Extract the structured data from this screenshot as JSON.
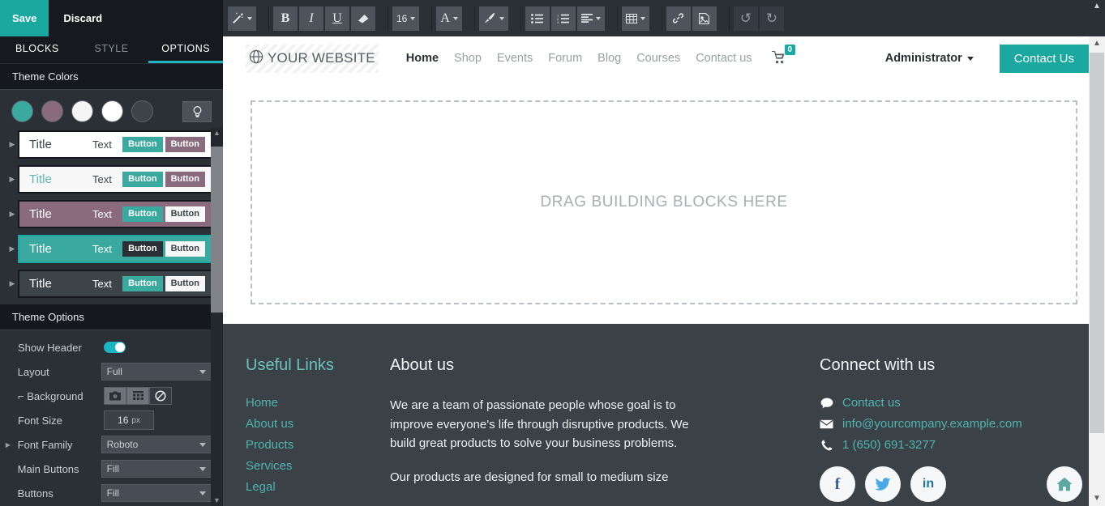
{
  "editor": {
    "save_label": "Save",
    "discard_label": "Discard",
    "tabs": [
      {
        "label": "BLOCKS",
        "active": false
      },
      {
        "label": "STYLE",
        "active": false
      },
      {
        "label": "OPTIONS",
        "active": true
      }
    ],
    "theme_colors": {
      "section_title": "Theme Colors",
      "swatches": [
        "#3aa9a0",
        "#8a6b7d",
        "#f5f5f5",
        "#ffffff",
        "#3c4449"
      ],
      "bulb_icon": "lightbulb-icon",
      "previews": [
        {
          "title": "Title",
          "text": "Text",
          "button1": "Button",
          "button2": "Button",
          "bg": "#ffffff",
          "title_color": "#3c4449",
          "text_color": "#3c4449",
          "b1_bg": "#3aa9a0",
          "b1_fg": "#ffffff",
          "b2_bg": "#8a6b7d",
          "b2_fg": "#ffffff",
          "selected": false
        },
        {
          "title": "Title",
          "text": "Text",
          "button1": "Button",
          "button2": "Button",
          "bg": "#f7f7f7",
          "title_color": "#5fb6b0",
          "text_color": "#3c4449",
          "b1_bg": "#3aa9a0",
          "b1_fg": "#ffffff",
          "b2_bg": "#8a6b7d",
          "b2_fg": "#ffffff",
          "selected": false
        },
        {
          "title": "Title",
          "text": "Text",
          "button1": "Button",
          "button2": "Button",
          "bg": "#8a6b7d",
          "title_color": "#ffffff",
          "text_color": "#ffffff",
          "b1_bg": "#3aa9a0",
          "b1_fg": "#ffffff",
          "b2_bg": "#f7f7f7",
          "b2_fg": "#3c4449",
          "selected": false
        },
        {
          "title": "Title",
          "text": "Text",
          "button1": "Button",
          "button2": "Button",
          "bg": "#3aa9a0",
          "title_color": "#ffffff",
          "text_color": "#ffffff",
          "b1_bg": "#2b3036",
          "b1_fg": "#ffffff",
          "b2_bg": "#f7f7f7",
          "b2_fg": "#3c4449",
          "selected": true
        },
        {
          "title": "Title",
          "text": "Text",
          "button1": "Button",
          "button2": "Button",
          "bg": "#3c4449",
          "title_color": "#ffffff",
          "text_color": "#ffffff",
          "b1_bg": "#3aa9a0",
          "b1_fg": "#ffffff",
          "b2_bg": "#f7f7f7",
          "b2_fg": "#3c4449",
          "selected": false
        }
      ]
    },
    "theme_options": {
      "section_title": "Theme Options",
      "show_header": {
        "label": "Show Header",
        "value": "on"
      },
      "layout": {
        "label": "Layout",
        "value": "Full"
      },
      "background": {
        "label": "⌐ Background",
        "buttons": [
          "camera-icon",
          "grid-icon",
          "no-background-icon"
        ],
        "active": "no-background-icon"
      },
      "font_size": {
        "label": "Font Size",
        "value": "16",
        "unit": "px"
      },
      "font_family": {
        "label": "Font Family",
        "value": "Roboto"
      },
      "main_buttons": {
        "label": "Main Buttons",
        "value": "Fill"
      },
      "buttons": {
        "label": "Buttons",
        "value": "Fill"
      }
    }
  },
  "toolbar": {
    "groups": [
      {
        "buttons": [
          {
            "icon": "magic-wand-icon",
            "glyph": "✨",
            "dropdown": true,
            "flat": false
          }
        ]
      },
      {
        "buttons": [
          {
            "icon": "bold-icon",
            "glyph": "B",
            "dropdown": false,
            "flat": false
          },
          {
            "icon": "italic-icon",
            "glyph": "I",
            "dropdown": false,
            "flat": false
          },
          {
            "icon": "underline-icon",
            "glyph": "U",
            "dropdown": false,
            "flat": false
          },
          {
            "icon": "clear-format-icon",
            "glyph": "◣",
            "dropdown": false,
            "flat": false
          }
        ]
      },
      {
        "buttons": [
          {
            "icon": "font-size-icon",
            "glyph": "16",
            "dropdown": true,
            "flat": false
          }
        ]
      },
      {
        "buttons": [
          {
            "icon": "text-color-icon",
            "glyph": "A",
            "dropdown": true,
            "flat": false
          }
        ]
      },
      {
        "buttons": [
          {
            "icon": "brush-icon",
            "glyph": "🖌",
            "dropdown": true,
            "flat": false
          }
        ]
      },
      {
        "buttons": [
          {
            "icon": "bullet-list-icon",
            "glyph": "☰",
            "dropdown": false,
            "flat": false
          },
          {
            "icon": "numbered-list-icon",
            "glyph": "≡",
            "dropdown": false,
            "flat": false
          },
          {
            "icon": "align-icon",
            "glyph": "≣",
            "dropdown": true,
            "flat": false
          }
        ]
      },
      {
        "buttons": [
          {
            "icon": "table-icon",
            "glyph": "⊞",
            "dropdown": true,
            "flat": false
          }
        ]
      },
      {
        "buttons": [
          {
            "icon": "link-icon",
            "glyph": "🔗",
            "dropdown": false,
            "flat": false
          },
          {
            "icon": "image-icon",
            "glyph": "🖼",
            "dropdown": false,
            "flat": false
          }
        ]
      },
      {
        "buttons": [
          {
            "icon": "undo-icon",
            "glyph": "↺",
            "dropdown": false,
            "flat": true
          },
          {
            "icon": "redo-icon",
            "glyph": "↻",
            "dropdown": false,
            "flat": true
          }
        ]
      }
    ]
  },
  "site": {
    "header": {
      "logo_icon": "globe-icon",
      "logo_text": "YOUR WEBSITE",
      "nav": [
        {
          "label": "Home",
          "active": true
        },
        {
          "label": "Shop",
          "active": false
        },
        {
          "label": "Events",
          "active": false
        },
        {
          "label": "Forum",
          "active": false
        },
        {
          "label": "Blog",
          "active": false
        },
        {
          "label": "Courses",
          "active": false
        },
        {
          "label": "Contact us",
          "active": false
        }
      ],
      "cart_icon": "shopping-cart-icon",
      "cart_count": "0",
      "user_label": "Administrator",
      "cta_label": "Contact Us"
    },
    "dropzone_label": "DRAG BUILDING BLOCKS HERE",
    "footer": {
      "useful_links": {
        "heading": "Useful Links",
        "links": [
          "Home",
          "About us",
          "Products",
          "Services",
          "Legal"
        ]
      },
      "about": {
        "heading": "About us",
        "paragraph1": "We are a team of passionate people whose goal is to improve everyone's life through disruptive products. We build great products to solve your business problems.",
        "paragraph2": "Our products are designed for small to medium size"
      },
      "connect": {
        "heading": "Connect with us",
        "contact_label": "Contact us",
        "contact_icon": "chat-bubble-icon",
        "email": "info@yourcompany.example.com",
        "email_icon": "envelope-icon",
        "phone": "1 (650) 691-3277",
        "phone_icon": "phone-icon",
        "socials": [
          {
            "icon": "facebook-icon",
            "glyph": "f",
            "color": "#3b5998"
          },
          {
            "icon": "twitter-icon",
            "glyph": "🐦",
            "color": "#4aa8e8"
          },
          {
            "icon": "linkedin-icon",
            "glyph": "in",
            "color": "#2074a8"
          },
          {
            "icon": "home-icon",
            "glyph": "⌂",
            "color": "#5aa89f"
          }
        ]
      }
    }
  }
}
